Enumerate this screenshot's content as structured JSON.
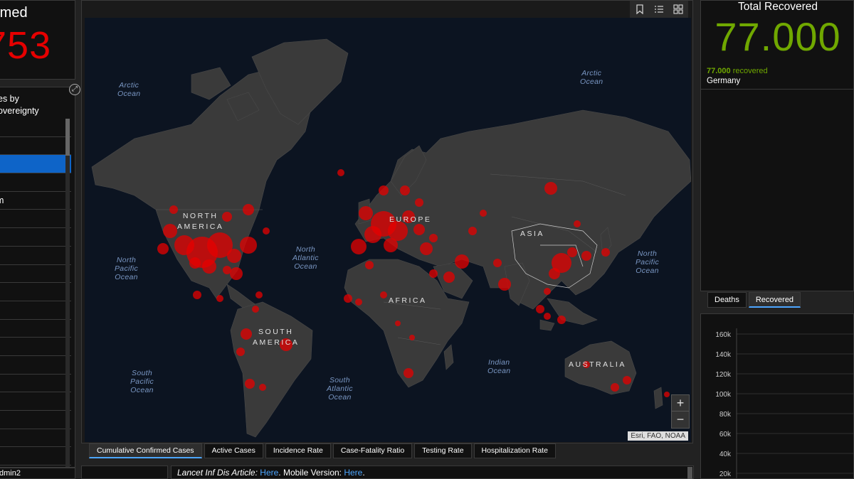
{
  "left": {
    "confirmed_title": "rmed",
    "confirmed_count": "753",
    "list_title_line1": "es by",
    "list_title_line2": "overeignty",
    "rows": [
      "",
      "",
      "",
      "",
      "m",
      "",
      "",
      "",
      "",
      "",
      "",
      "",
      "",
      "",
      "",
      "",
      "",
      "",
      ""
    ],
    "selected_row": 2,
    "expand_icon": "expand-icon",
    "admin_label": "dmin2"
  },
  "map": {
    "toolbar_icons": [
      "bookmark-icon",
      "list-icon",
      "grid-icon"
    ],
    "ocean_labels": {
      "arctic_w": "Arctic\nOcean",
      "arctic_e": "Arctic\nOcean",
      "north_pacific_w": "North\nPacific\nOcean",
      "north_atlantic": "North\nAtlantic\nOcean",
      "north_pacific_e": "North\nPacific\nOcean",
      "south_pacific": "South\nPacific\nOcean",
      "south_atlantic": "South\nAtlantic\nOcean",
      "indian": "Indian\nOcean"
    },
    "continent_labels": {
      "north_america": "NORTH\nAMERICA",
      "europe": "EUROPE",
      "asia": "ASIA",
      "africa": "AFRICA",
      "south_america": "SOUTH\nAMERICA",
      "australia": "AUSTRALIA"
    },
    "zoom_in": "+",
    "zoom_out": "−",
    "attribution": "Esri, FAO, NOAA",
    "colors": {
      "ocean": "#0c1421",
      "land": "#3a3a3a",
      "marker": "#e60000"
    }
  },
  "map_tabs": [
    "Cumulative Confirmed Cases",
    "Active Cases",
    "Incidence Rate",
    "Case-Fatality Ratio",
    "Testing Rate",
    "Hospitalization Rate"
  ],
  "map_tabs_active": 0,
  "info": {
    "article": "Lancet Inf Dis Article: ",
    "link1": "Here",
    "mobile": ". Mobile Version: ",
    "link2": "Here",
    "end": "."
  },
  "right": {
    "title": "Total Recovered",
    "value": "77.000",
    "detail_number": "77.000",
    "detail_text": " recovered",
    "country": "Germany",
    "tabs": [
      "Deaths",
      "Recovered"
    ],
    "active_tab": 1,
    "accent": "#70a800"
  },
  "chart_data": {
    "type": "line",
    "y_ticks": [
      "160k",
      "140k",
      "120k",
      "100k",
      "80k",
      "60k",
      "40k",
      "20k"
    ],
    "ylim": [
      20000,
      160000
    ],
    "series": []
  }
}
